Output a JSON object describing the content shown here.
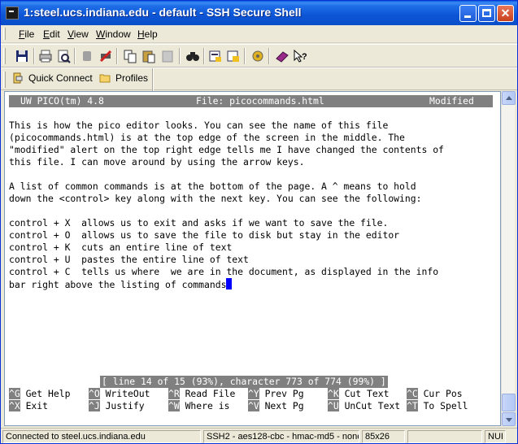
{
  "window": {
    "title": "1:steel.ucs.indiana.edu - default - SSH Secure Shell"
  },
  "menu": [
    {
      "label": "File",
      "key": "F",
      "rest": "ile"
    },
    {
      "label": "Edit",
      "key": "E",
      "rest": "dit"
    },
    {
      "label": "View",
      "key": "V",
      "rest": "iew"
    },
    {
      "label": "Window",
      "key": "W",
      "rest": "indow"
    },
    {
      "label": "Help",
      "key": "H",
      "rest": "elp"
    }
  ],
  "toolbar2": {
    "quick_connect": "Quick Connect",
    "profiles": "Profiles"
  },
  "pico": {
    "version": "UW PICO(tm) 4.8",
    "file": "File: picocommands.html",
    "modified": "Modified",
    "lines": [
      "This is how the pico editor looks. You can see the name of this file",
      "(picocommands.html) is at the top edge of the screen in the middle. The",
      "\"modified\" alert on the top right edge tells me I have changed the contents of",
      "this file. I can move around by using the arrow keys.",
      "",
      "A list of common commands is at the bottom of the page. A ^ means to hold",
      "down the <control> key along with the next key. You can see the following:",
      "",
      "control + X  allows us to exit and asks if we want to save the file.",
      "control + O  allows us to save the file to disk but stay in the editor",
      "control + K  cuts an entire line of text",
      "control + U  pastes the entire line of text",
      "control + C  tells us where  we are in the document, as displayed in the info",
      "bar right above the listing of commands"
    ],
    "status": "[ line 14 of 15 (93%), character 773 of 774 (99%) ]",
    "shortcuts_row1": [
      {
        "key": "^G",
        "label": "Get Help"
      },
      {
        "key": "^O",
        "label": "WriteOut"
      },
      {
        "key": "^R",
        "label": "Read File"
      },
      {
        "key": "^Y",
        "label": "Prev Pg"
      },
      {
        "key": "^K",
        "label": "Cut Text"
      },
      {
        "key": "^C",
        "label": "Cur Pos"
      }
    ],
    "shortcuts_row2": [
      {
        "key": "^X",
        "label": "Exit"
      },
      {
        "key": "^J",
        "label": "Justify"
      },
      {
        "key": "^W",
        "label": "Where is"
      },
      {
        "key": "^V",
        "label": "Next Pg"
      },
      {
        "key": "^U",
        "label": "UnCut Text"
      },
      {
        "key": "^T",
        "label": "To Spell"
      }
    ]
  },
  "statusbar": {
    "connection": "Connected to steel.ucs.indiana.edu",
    "cipher": "SSH2 - aes128-cbc - hmac-md5 - none",
    "size": "85x26",
    "num": "NUI"
  },
  "colors": {
    "titlebar": "#0c55d6",
    "cursor": "#0000ff",
    "pico_bar": "#808080"
  }
}
